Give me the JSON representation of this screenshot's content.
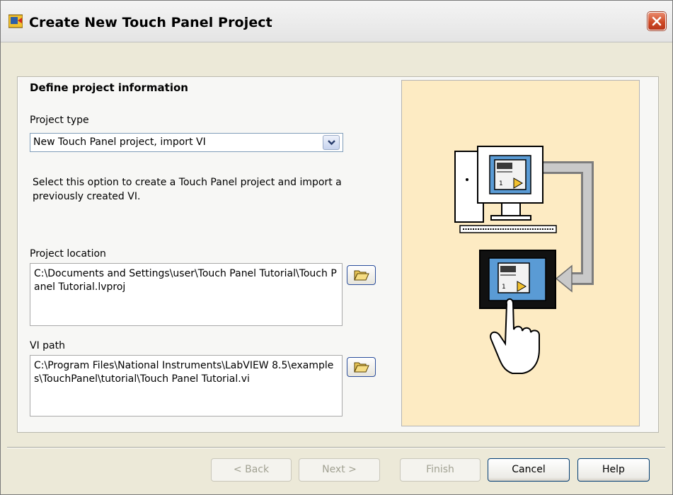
{
  "window": {
    "title": "Create New Touch Panel Project"
  },
  "form": {
    "heading": "Define project information",
    "project_type_label": "Project type",
    "project_type_value": "New Touch Panel project, import VI",
    "description": "Select this option to create a Touch Panel project and import a previously created VI.",
    "project_location_label": "Project location",
    "project_location_value": "C:\\Documents and Settings\\user\\Touch Panel Tutorial\\Touch Panel Tutorial.lvproj",
    "vi_path_label": "VI path",
    "vi_path_value": "C:\\Program Files\\National Instruments\\LabVIEW 8.5\\examples\\TouchPanel\\tutorial\\Touch Panel Tutorial.vi"
  },
  "illustration": {
    "screen_digit": "1"
  },
  "buttons": {
    "back": "< Back",
    "next": "Next >",
    "finish": "Finish",
    "cancel": "Cancel",
    "help": "Help"
  },
  "icons": {
    "app": "labview-touch-panel-icon",
    "close": "close-icon",
    "dropdown": "chevron-down-icon",
    "browse": "folder-open-icon"
  },
  "colors": {
    "illustration_bg": "#fdebc3",
    "close_button": "#cf4b27",
    "screen_blue": "#5a9bd5"
  }
}
